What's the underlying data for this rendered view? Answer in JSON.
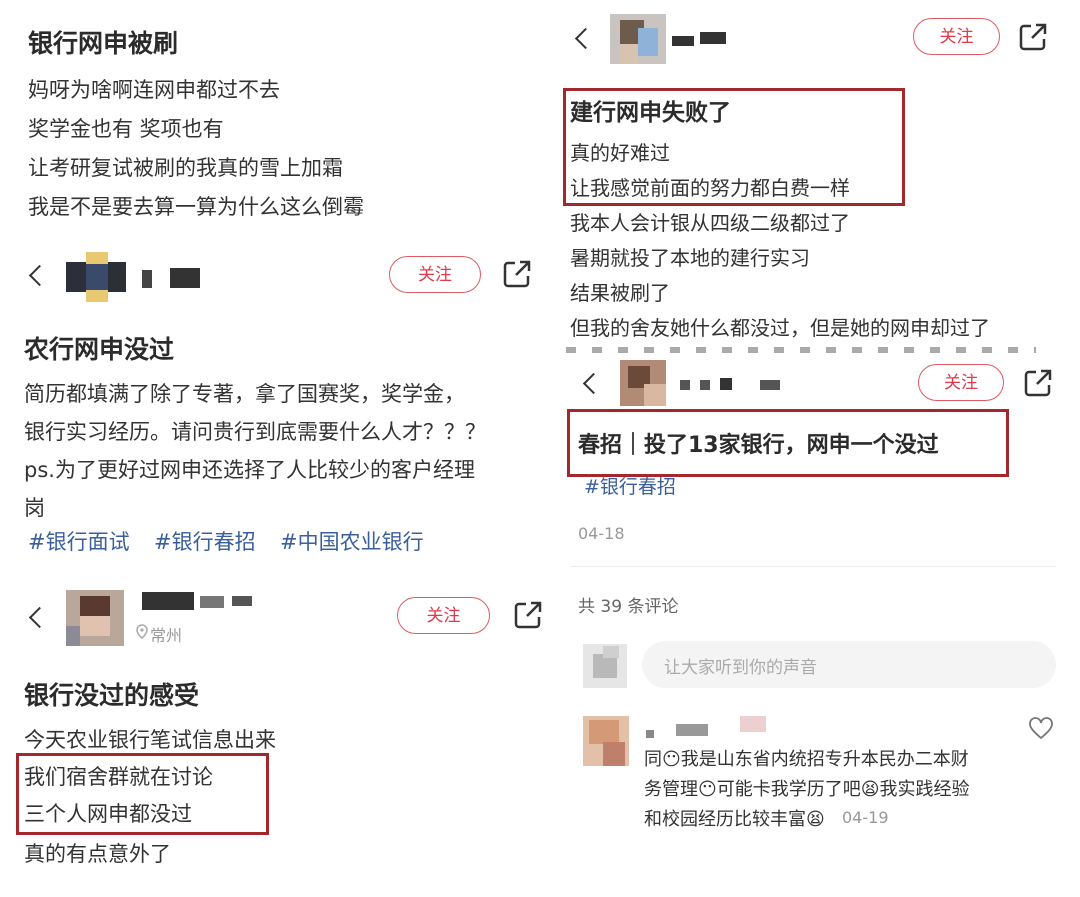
{
  "post1": {
    "title": "银行网申被刷",
    "lines": [
      "妈呀为啥啊连网申都过不去",
      "奖学金也有 奖项也有",
      "让考研复试被刷的我真的雪上加霜",
      "我是不是要去算一算为什么这么倒霉"
    ]
  },
  "post2": {
    "follow": "关注",
    "title": "农行网申没过",
    "lines": [
      "简历都填满了除了专著，拿了国赛奖，奖学金，",
      "银行实习经历。请问贵行到底需要什么人才？？？",
      "ps.为了更好过网申还选择了人比较少的客户经理",
      "岗"
    ],
    "tags": [
      "#银行面试",
      "#银行春招",
      "#中国农业银行"
    ]
  },
  "post3": {
    "follow": "关注",
    "location": "常州",
    "title": "银行没过的感受",
    "lines": [
      "今天农业银行笔试信息出来",
      "我们宿舍群就在讨论",
      "三个人网申都没过",
      "真的有点意外了"
    ]
  },
  "post4": {
    "follow": "关注",
    "title": "建行网申失败了",
    "lines": [
      "真的好难过",
      "让我感觉前面的努力都白费一样",
      "我本人会计银从四级二级都过了",
      "暑期就投了本地的建行实习",
      "结果被刷了",
      "但我的舍友她什么都没过，但是她的网申却过了"
    ]
  },
  "post5": {
    "follow": "关注",
    "title": "春招｜投了13家银行，网申一个没过",
    "tag": "#银行春招",
    "date": "04-18",
    "comment_count": "共 39 条评论",
    "comment_placeholder": "让大家听到你的声音",
    "comment": {
      "lines": [
        "同😶我是山东省内统招专升本民办二本财",
        "务管理😶可能卡我学历了吧😫我实践经验",
        "和校园经历比较丰富😫"
      ],
      "date": "04-19"
    }
  },
  "icons": {
    "back": "chevron-left-icon",
    "share": "share-icon",
    "heart": "heart-icon",
    "location": "location-pin-icon"
  },
  "colors": {
    "highlight": "#a4272b",
    "follow": "#e0394a",
    "tag": "#3a5f9c"
  }
}
